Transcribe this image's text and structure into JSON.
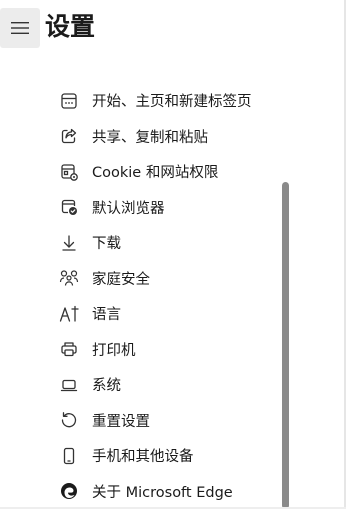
{
  "header": {
    "title": "设置",
    "menu_icon": "hamburger-icon"
  },
  "nav": {
    "items": [
      {
        "label": "开始、主页和新建标签页",
        "icon": "home-tab-icon"
      },
      {
        "label": "共享、复制和粘贴",
        "icon": "share-icon"
      },
      {
        "label": "Cookie 和网站权限",
        "icon": "site-permissions-icon"
      },
      {
        "label": "默认浏览器",
        "icon": "default-browser-icon"
      },
      {
        "label": "下载",
        "icon": "download-icon"
      },
      {
        "label": "家庭安全",
        "icon": "family-icon"
      },
      {
        "label": "语言",
        "icon": "language-icon"
      },
      {
        "label": "打印机",
        "icon": "printer-icon"
      },
      {
        "label": "系统",
        "icon": "laptop-icon"
      },
      {
        "label": "重置设置",
        "icon": "reset-icon"
      },
      {
        "label": "手机和其他设备",
        "icon": "phone-icon"
      },
      {
        "label": "关于 Microsoft Edge",
        "icon": "edge-logo-icon"
      }
    ]
  }
}
